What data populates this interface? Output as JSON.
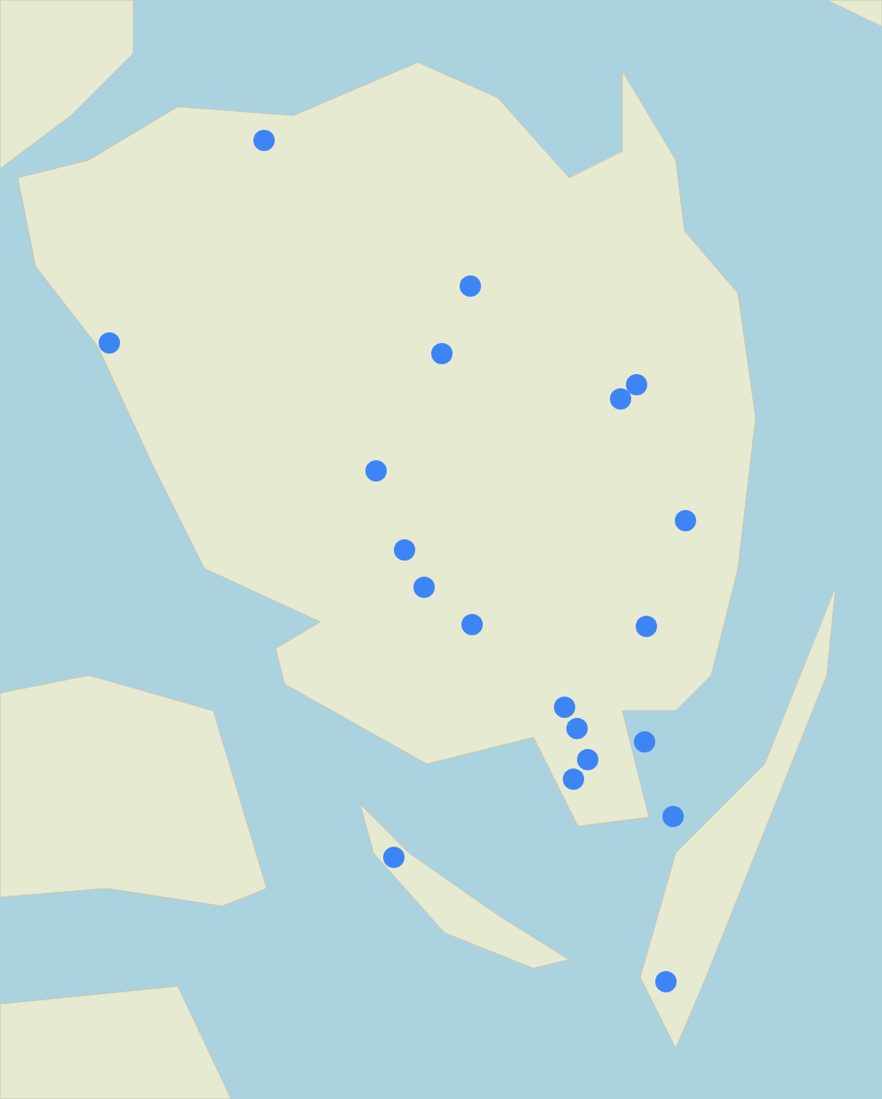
{
  "map": {
    "markers": [
      {
        "kind": "point"
      },
      {
        "kind": "point"
      },
      {
        "kind": "point"
      },
      {
        "kind": "point"
      },
      {
        "kind": "point"
      },
      {
        "kind": "point"
      },
      {
        "kind": "point"
      },
      {
        "kind": "point"
      },
      {
        "kind": "point"
      },
      {
        "kind": "point"
      },
      {
        "kind": "point"
      },
      {
        "kind": "point"
      },
      {
        "kind": "point"
      },
      {
        "kind": "point"
      },
      {
        "kind": "point"
      },
      {
        "kind": "point"
      },
      {
        "kind": "point"
      },
      {
        "kind": "point"
      },
      {
        "kind": "point"
      },
      {
        "kind": "point"
      }
    ]
  }
}
